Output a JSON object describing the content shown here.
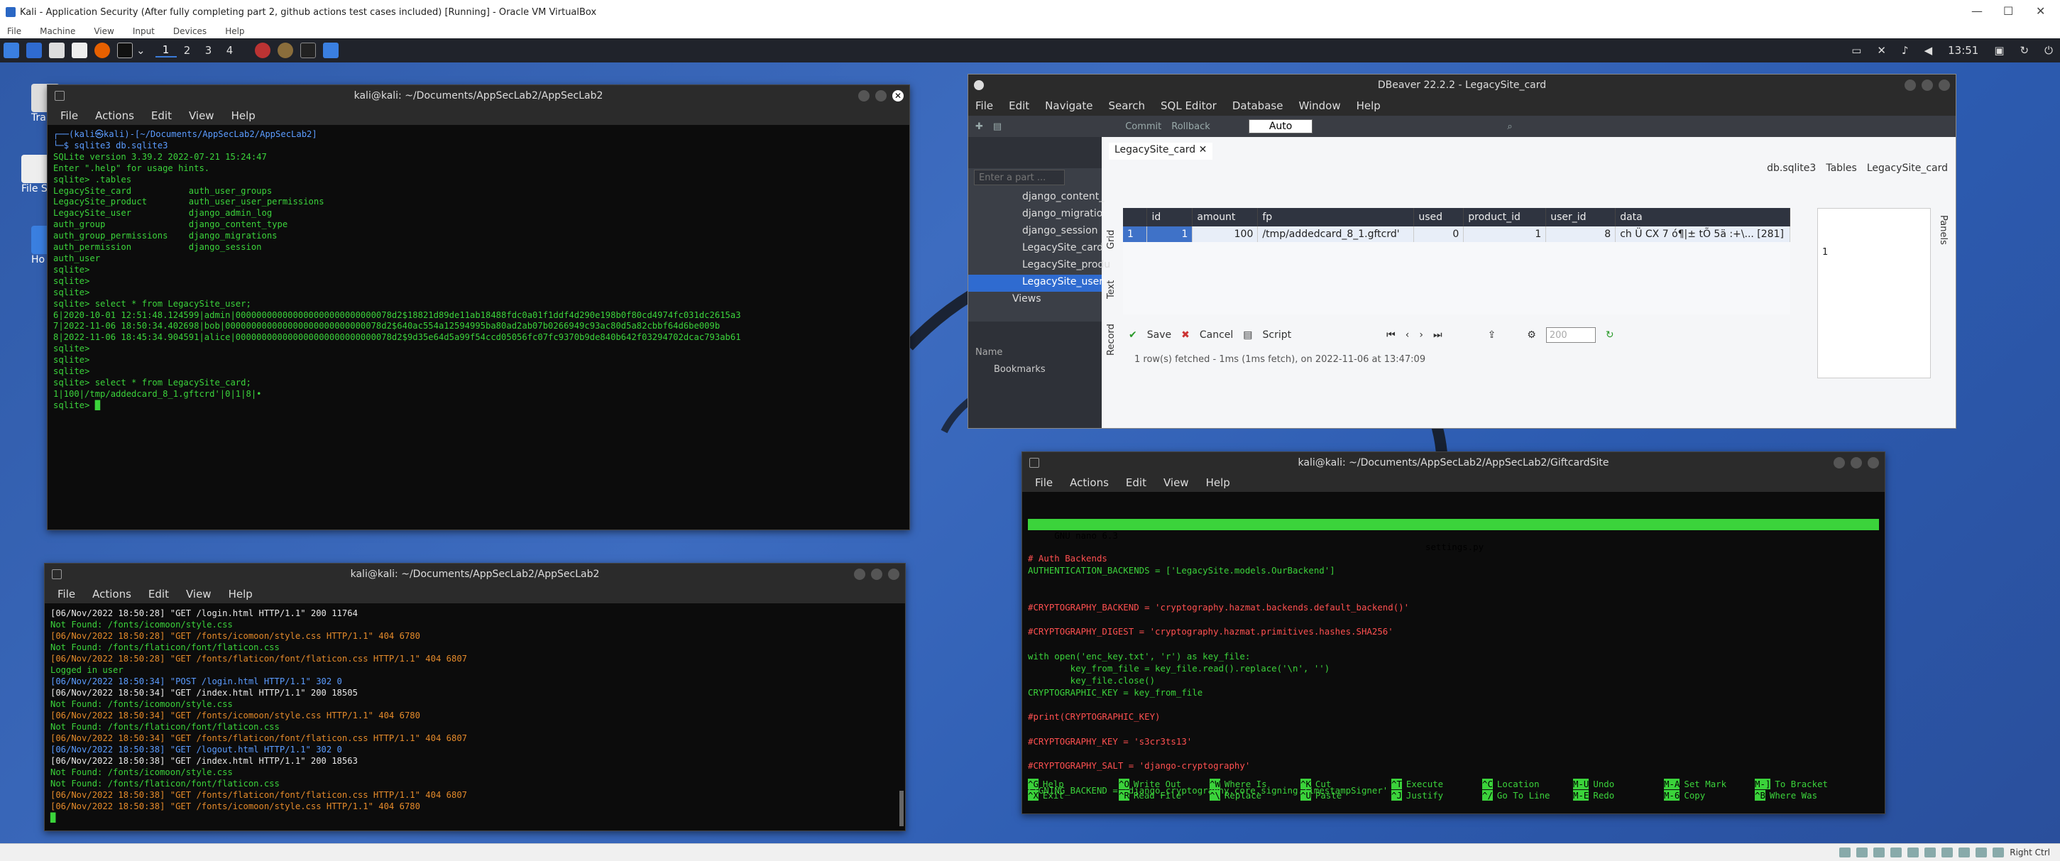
{
  "vbox": {
    "title": "Kali - Application Security (After fully completing part 2, github actions test cases included) [Running] - Oracle VM VirtualBox",
    "menu": [
      "File",
      "Machine",
      "View",
      "Input",
      "Devices",
      "Help"
    ],
    "status_right": "Right Ctrl"
  },
  "panel": {
    "workspaces": [
      "1",
      "2",
      "3",
      "4"
    ],
    "clock": "13:51"
  },
  "desktop": {
    "icons": [
      "Tra",
      "File S",
      "Ho"
    ]
  },
  "term1": {
    "title": "kali@kali: ~/Documents/AppSecLab2/AppSecLab2",
    "menu": [
      "File",
      "Actions",
      "Edit",
      "View",
      "Help"
    ],
    "prompt_top": "┌──(kali㉿kali)-[~/Documents/AppSecLab2/AppSecLab2]",
    "prompt_cmd": "└─$ sqlite3 db.sqlite3",
    "lines": [
      "SQLite version 3.39.2 2022-07-21 15:24:47",
      "Enter \".help\" for usage hints.",
      "sqlite> .tables",
      "LegacySite_card           auth_user_groups",
      "LegacySite_product        auth_user_user_permissions",
      "LegacySite_user           django_admin_log",
      "auth_group                django_content_type",
      "auth_group_permissions    django_migrations",
      "auth_permission           django_session",
      "auth_user",
      "sqlite>",
      "sqlite>",
      "sqlite>",
      "sqlite> select * from LegacySite_user;",
      "6|2020-10-01 12:51:48.124599|admin|000000000000000000000000000078d2$18821d89de11ab18488fdc0a01f1ddf4d290e198b0f80cd4974fc031dc2615a3",
      "7|2022-11-06 18:50:34.402698|bob|000000000000000000000000000078d2$640ac554a12594995ba80ad2ab07b0266949c93ac80d5a82cbbf64d6be009b",
      "8|2022-11-06 18:45:34.904591|alice|000000000000000000000000000078d2$9d35e64d5a99f54ccd05056fc07fc9370b9de840b642f03294702dcac793ab61",
      "sqlite>",
      "sqlite>",
      "sqlite>",
      "sqlite> select * from LegacySite_card;",
      "1|100|/tmp/addedcard_8_1.gftcrd'|0|1|8|•",
      "sqlite> █"
    ]
  },
  "term2": {
    "title": "kali@kali: ~/Documents/AppSecLab2/AppSecLab2",
    "menu": [
      "File",
      "Actions",
      "Edit",
      "View",
      "Help"
    ],
    "lines": [
      {
        "t": "[06/Nov/2022 18:50:28] \"GET /login.html HTTP/1.1\" 200 11764",
        "c": "w"
      },
      {
        "t": "Not Found: /fonts/icomoon/style.css",
        "c": "g"
      },
      {
        "t": "[06/Nov/2022 18:50:28] \"GET /fonts/icomoon/style.css HTTP/1.1\" 404 6780",
        "c": "o"
      },
      {
        "t": "Not Found: /fonts/flaticon/font/flaticon.css",
        "c": "g"
      },
      {
        "t": "[06/Nov/2022 18:50:28] \"GET /fonts/flaticon/font/flaticon.css HTTP/1.1\" 404 6807",
        "c": "o"
      },
      {
        "t": "Logged in user",
        "c": "g"
      },
      {
        "t": "[06/Nov/2022 18:50:34] \"POST /login.html HTTP/1.1\" 302 0",
        "c": "b"
      },
      {
        "t": "[06/Nov/2022 18:50:34] \"GET /index.html HTTP/1.1\" 200 18505",
        "c": "w"
      },
      {
        "t": "Not Found: /fonts/icomoon/style.css",
        "c": "g"
      },
      {
        "t": "[06/Nov/2022 18:50:34] \"GET /fonts/icomoon/style.css HTTP/1.1\" 404 6780",
        "c": "o"
      },
      {
        "t": "Not Found: /fonts/flaticon/font/flaticon.css",
        "c": "g"
      },
      {
        "t": "[06/Nov/2022 18:50:34] \"GET /fonts/flaticon/font/flaticon.css HTTP/1.1\" 404 6807",
        "c": "o"
      },
      {
        "t": "[06/Nov/2022 18:50:38] \"GET /logout.html HTTP/1.1\" 302 0",
        "c": "b"
      },
      {
        "t": "[06/Nov/2022 18:50:38] \"GET /index.html HTTP/1.1\" 200 18563",
        "c": "w"
      },
      {
        "t": "Not Found: /fonts/icomoon/style.css",
        "c": "g"
      },
      {
        "t": "Not Found: /fonts/flaticon/font/flaticon.css",
        "c": "g"
      },
      {
        "t": "[06/Nov/2022 18:50:38] \"GET /fonts/flaticon/font/flaticon.css HTTP/1.1\" 404 6807",
        "c": "o"
      },
      {
        "t": "[06/Nov/2022 18:50:38] \"GET /fonts/icomoon/style.css HTTP/1.1\" 404 6780",
        "c": "o"
      },
      {
        "t": "█",
        "c": "g"
      }
    ]
  },
  "dbeaver": {
    "title": "DBeaver 22.2.2 - LegacySite_card",
    "menu": [
      "File",
      "Edit",
      "Navigate",
      "Search",
      "SQL Editor",
      "Database",
      "Window",
      "Help"
    ],
    "commit": "Commit",
    "rollback": "Rollback",
    "auto": "Auto",
    "editor_tab": "LegacySite_card",
    "db_crumb": "db.sqlite3",
    "tables_crumb": "Tables",
    "table_crumb": "LegacySite_card",
    "filter_placeholder": "Enter a part ...",
    "nav_items": [
      "django_content_",
      "django_migratio",
      "django_session",
      "LegacySite_card",
      "LegacySite_produ",
      "LegacySite_user",
      "Views"
    ],
    "name_header": "Name",
    "bookmarks": "Bookmarks",
    "side_tabs": [
      "Grid",
      "Text",
      "Record"
    ],
    "columns": [
      "id",
      "amount",
      "fp",
      "used",
      "product_id",
      "user_id",
      "data"
    ],
    "row": [
      "1",
      "1",
      "100",
      "/tmp/addedcard_8_1.gftcrd'",
      "0",
      "1",
      "8",
      "ch Ü CX 7  ó¶|± tÕ 5ä :+\\... [281]"
    ],
    "save": "Save",
    "cancel": "Cancel",
    "script": "Script",
    "limit": "200",
    "status": "1 row(s) fetched - 1ms (1ms fetch), on 2022-11-06 at 13:47:09",
    "panel_value": "1",
    "panels_label": "Panels"
  },
  "nano": {
    "title": "kali@kali: ~/Documents/AppSecLab2/AppSecLab2/GiftcardSite",
    "menu": [
      "File",
      "Actions",
      "Edit",
      "View",
      "Help"
    ],
    "header_left": " GNU nano 6.3",
    "header_center": "settings.py",
    "lines": [
      {
        "t": "# Auth Backends",
        "c": "r"
      },
      {
        "t": "AUTHENTICATION_BACKENDS = ['LegacySite.models.OurBackend']",
        "c": "g"
      },
      {
        "t": "",
        "c": "g"
      },
      {
        "t": "",
        "c": "g"
      },
      {
        "t": "#CRYPTOGRAPHY_BACKEND = 'cryptography.hazmat.backends.default_backend()'",
        "c": "r"
      },
      {
        "t": "",
        "c": "g"
      },
      {
        "t": "#CRYPTOGRAPHY_DIGEST = 'cryptography.hazmat.primitives.hashes.SHA256'",
        "c": "r"
      },
      {
        "t": "",
        "c": "g"
      },
      {
        "t": "with open('enc_key.txt', 'r') as key_file:",
        "c": "g"
      },
      {
        "t": "        key_from_file = key_file.read().replace('\\n', '')",
        "c": "g"
      },
      {
        "t": "        key_file.close()",
        "c": "g"
      },
      {
        "t": "CRYPTOGRAPHIC_KEY = key_from_file",
        "c": "g"
      },
      {
        "t": "",
        "c": "g"
      },
      {
        "t": "#print(CRYPTOGRAPHIC_KEY)",
        "c": "r"
      },
      {
        "t": "",
        "c": "g"
      },
      {
        "t": "#CRYPTOGRAPHY_KEY = 's3cr3ts13'",
        "c": "r"
      },
      {
        "t": "",
        "c": "g"
      },
      {
        "t": "#CRYPTOGRAPHY_SALT = 'django-cryptography'",
        "c": "r"
      },
      {
        "t": "",
        "c": "g"
      },
      {
        "t": "SIGNING_BACKEND = 'django_cryptography.core.signing.TimestampSigner'",
        "c": "g"
      },
      {
        "t": "",
        "c": "g"
      },
      {
        "t": "",
        "c": "g"
      },
      {
        "t": "█",
        "c": "g"
      }
    ],
    "shortcuts_row1": [
      [
        "^G",
        "Help"
      ],
      [
        "^O",
        "Write Out"
      ],
      [
        "^W",
        "Where Is"
      ],
      [
        "^K",
        "Cut"
      ],
      [
        "^T",
        "Execute"
      ],
      [
        "^C",
        "Location"
      ],
      [
        "M-U",
        "Undo"
      ],
      [
        "M-A",
        "Set Mark"
      ],
      [
        "M-]",
        "To Bracket"
      ]
    ],
    "shortcuts_row2": [
      [
        "^X",
        "Exit"
      ],
      [
        "^R",
        "Read File"
      ],
      [
        "^\\",
        "Replace"
      ],
      [
        "^U",
        "Paste"
      ],
      [
        "^J",
        "Justify"
      ],
      [
        "^/",
        "Go To Line"
      ],
      [
        "M-E",
        "Redo"
      ],
      [
        "M-6",
        "Copy"
      ],
      [
        "^B",
        "Where Was"
      ]
    ]
  }
}
